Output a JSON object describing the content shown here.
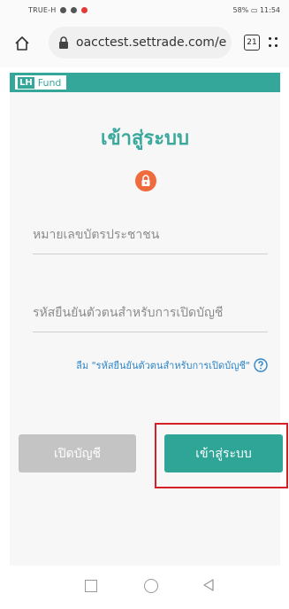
{
  "status_bar": {
    "carrier": "TRUE-H",
    "right": "58%",
    "time": "11:54"
  },
  "browser": {
    "url": "oacctest.settrade.com/e",
    "tab_count": "21"
  },
  "header": {
    "logo_lh": "LH",
    "logo_fund": "Fund"
  },
  "login": {
    "title": "เข้าสู่ระบบ",
    "id_placeholder": "หมายเลขบัตรประชาชน",
    "pin_placeholder": "รหัสยืนยันตัวตนสำหรับการเปิดบัญชี",
    "forgot_text": "ลืม \"รหัสยืนยันตัวตนสำหรับการเปิดบัญชี\"",
    "open_account_label": "เปิดบัญชี",
    "login_label": "เข้าสู่ระบบ"
  },
  "colors": {
    "brand": "#34a69a",
    "login_button": "#2fa597",
    "disabled_button": "#c4c4c4",
    "lock_icon": "#ef6a3c",
    "link": "#2f86c9",
    "highlight": "#d61f26"
  },
  "icons": [
    "home-icon",
    "lock-icon",
    "tab-switcher-icon",
    "menu-icon",
    "padlock-icon",
    "help-icon",
    "nav-recents-icon",
    "nav-home-icon",
    "nav-back-icon"
  ]
}
